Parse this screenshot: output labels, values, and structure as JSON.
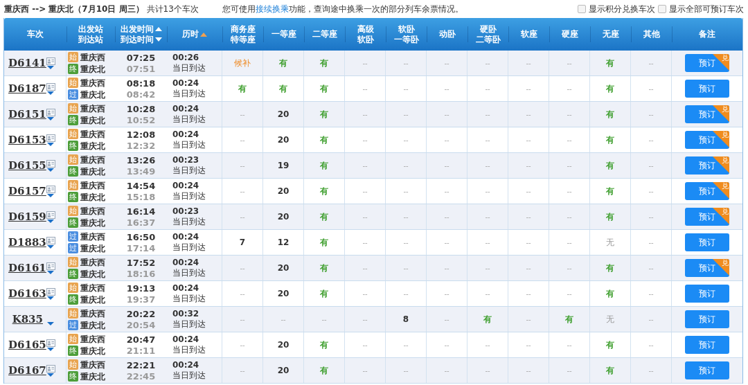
{
  "summary": {
    "route": "重庆西 --> 重庆北（7月10日  周三）",
    "count": "共计13个车次"
  },
  "notice": {
    "before": "您可使用",
    "link": "接续换乘",
    "after": "功能，查询途中换乘一次的部分列车余票情况。"
  },
  "options": [
    {
      "label": "显示积分兑换车次",
      "checked": false
    },
    {
      "label": "显示全部可预订车次",
      "checked": false
    }
  ],
  "columns": [
    {
      "lines": [
        {
          "text": "车次"
        }
      ]
    },
    {
      "lines": [
        {
          "text": "出发站"
        },
        {
          "text": "到达站"
        }
      ]
    },
    {
      "lines": [
        {
          "text": "出发时间",
          "kind": "asc",
          "active": false
        },
        {
          "text": "到达时间",
          "kind": "desc",
          "active": false
        }
      ]
    },
    {
      "lines": [
        {
          "text": "历时",
          "kind": "asc",
          "active": true
        }
      ]
    },
    {
      "lines": [
        {
          "text": "商务座"
        },
        {
          "text": "特等座"
        }
      ]
    },
    {
      "lines": [
        {
          "text": "一等座"
        }
      ]
    },
    {
      "lines": [
        {
          "text": "二等座"
        }
      ]
    },
    {
      "lines": [
        {
          "text": "高级"
        },
        {
          "text": "软卧"
        }
      ]
    },
    {
      "lines": [
        {
          "text": "软卧"
        },
        {
          "text": "一等卧"
        }
      ]
    },
    {
      "lines": [
        {
          "text": "动卧"
        }
      ]
    },
    {
      "lines": [
        {
          "text": "硬卧"
        },
        {
          "text": "二等卧"
        }
      ]
    },
    {
      "lines": [
        {
          "text": "软座"
        }
      ]
    },
    {
      "lines": [
        {
          "text": "硬座"
        }
      ]
    },
    {
      "lines": [
        {
          "text": "无座"
        }
      ]
    },
    {
      "lines": [
        {
          "text": "其他"
        }
      ]
    },
    {
      "lines": [
        {
          "text": "备注"
        }
      ]
    }
  ],
  "trains": [
    {
      "number": "D6141",
      "info_icon": true,
      "from": {
        "badge": "始",
        "kind": "start",
        "name": "重庆西"
      },
      "to": {
        "badge": "终",
        "kind": "end",
        "name": "重庆北"
      },
      "depart": "07:25",
      "arrive": "07:51",
      "duration": "00:26",
      "arrival_day": "当日到达",
      "seats": [
        {
          "text": "候补",
          "kind": "waitlist"
        },
        {
          "text": "有",
          "kind": "avail"
        },
        {
          "text": "有",
          "kind": "avail"
        },
        {
          "text": "--",
          "kind": "na"
        },
        {
          "text": "--",
          "kind": "na"
        },
        {
          "text": "--",
          "kind": "na"
        },
        {
          "text": "--",
          "kind": "na"
        },
        {
          "text": "--",
          "kind": "na"
        },
        {
          "text": "--",
          "kind": "na"
        },
        {
          "text": "有",
          "kind": "avail"
        },
        {
          "text": "--",
          "kind": "na"
        }
      ],
      "button": "预订",
      "badge": "兑"
    },
    {
      "number": "D6187",
      "info_icon": true,
      "from": {
        "badge": "始",
        "kind": "start",
        "name": "重庆西"
      },
      "to": {
        "badge": "过",
        "kind": "pass",
        "name": "重庆北"
      },
      "depart": "08:18",
      "arrive": "08:42",
      "duration": "00:24",
      "arrival_day": "当日到达",
      "seats": [
        {
          "text": "有",
          "kind": "avail"
        },
        {
          "text": "有",
          "kind": "avail"
        },
        {
          "text": "有",
          "kind": "avail"
        },
        {
          "text": "--",
          "kind": "na"
        },
        {
          "text": "--",
          "kind": "na"
        },
        {
          "text": "--",
          "kind": "na"
        },
        {
          "text": "--",
          "kind": "na"
        },
        {
          "text": "--",
          "kind": "na"
        },
        {
          "text": "--",
          "kind": "na"
        },
        {
          "text": "有",
          "kind": "avail"
        },
        {
          "text": "--",
          "kind": "na"
        }
      ],
      "button": "预订"
    },
    {
      "number": "D6151",
      "info_icon": true,
      "from": {
        "badge": "始",
        "kind": "start",
        "name": "重庆西"
      },
      "to": {
        "badge": "终",
        "kind": "end",
        "name": "重庆北"
      },
      "depart": "10:28",
      "arrive": "10:52",
      "duration": "00:24",
      "arrival_day": "当日到达",
      "seats": [
        {
          "text": "--",
          "kind": "na"
        },
        {
          "text": "20",
          "kind": "count"
        },
        {
          "text": "有",
          "kind": "avail"
        },
        {
          "text": "--",
          "kind": "na"
        },
        {
          "text": "--",
          "kind": "na"
        },
        {
          "text": "--",
          "kind": "na"
        },
        {
          "text": "--",
          "kind": "na"
        },
        {
          "text": "--",
          "kind": "na"
        },
        {
          "text": "--",
          "kind": "na"
        },
        {
          "text": "有",
          "kind": "avail"
        },
        {
          "text": "--",
          "kind": "na"
        }
      ],
      "button": "预订",
      "badge": "兑"
    },
    {
      "number": "D6153",
      "info_icon": true,
      "from": {
        "badge": "始",
        "kind": "start",
        "name": "重庆西"
      },
      "to": {
        "badge": "终",
        "kind": "end",
        "name": "重庆北"
      },
      "depart": "12:08",
      "arrive": "12:32",
      "duration": "00:24",
      "arrival_day": "当日到达",
      "seats": [
        {
          "text": "--",
          "kind": "na"
        },
        {
          "text": "20",
          "kind": "count"
        },
        {
          "text": "有",
          "kind": "avail"
        },
        {
          "text": "--",
          "kind": "na"
        },
        {
          "text": "--",
          "kind": "na"
        },
        {
          "text": "--",
          "kind": "na"
        },
        {
          "text": "--",
          "kind": "na"
        },
        {
          "text": "--",
          "kind": "na"
        },
        {
          "text": "--",
          "kind": "na"
        },
        {
          "text": "有",
          "kind": "avail"
        },
        {
          "text": "--",
          "kind": "na"
        }
      ],
      "button": "预订",
      "badge": "兑"
    },
    {
      "number": "D6155",
      "info_icon": true,
      "from": {
        "badge": "始",
        "kind": "start",
        "name": "重庆西"
      },
      "to": {
        "badge": "终",
        "kind": "end",
        "name": "重庆北"
      },
      "depart": "13:26",
      "arrive": "13:49",
      "duration": "00:23",
      "arrival_day": "当日到达",
      "seats": [
        {
          "text": "--",
          "kind": "na"
        },
        {
          "text": "19",
          "kind": "count"
        },
        {
          "text": "有",
          "kind": "avail"
        },
        {
          "text": "--",
          "kind": "na"
        },
        {
          "text": "--",
          "kind": "na"
        },
        {
          "text": "--",
          "kind": "na"
        },
        {
          "text": "--",
          "kind": "na"
        },
        {
          "text": "--",
          "kind": "na"
        },
        {
          "text": "--",
          "kind": "na"
        },
        {
          "text": "有",
          "kind": "avail"
        },
        {
          "text": "--",
          "kind": "na"
        }
      ],
      "button": "预订",
      "badge": "兑"
    },
    {
      "number": "D6157",
      "info_icon": true,
      "from": {
        "badge": "始",
        "kind": "start",
        "name": "重庆西"
      },
      "to": {
        "badge": "终",
        "kind": "end",
        "name": "重庆北"
      },
      "depart": "14:54",
      "arrive": "15:18",
      "duration": "00:24",
      "arrival_day": "当日到达",
      "seats": [
        {
          "text": "--",
          "kind": "na"
        },
        {
          "text": "20",
          "kind": "count"
        },
        {
          "text": "有",
          "kind": "avail"
        },
        {
          "text": "--",
          "kind": "na"
        },
        {
          "text": "--",
          "kind": "na"
        },
        {
          "text": "--",
          "kind": "na"
        },
        {
          "text": "--",
          "kind": "na"
        },
        {
          "text": "--",
          "kind": "na"
        },
        {
          "text": "--",
          "kind": "na"
        },
        {
          "text": "有",
          "kind": "avail"
        },
        {
          "text": "--",
          "kind": "na"
        }
      ],
      "button": "预订",
      "badge": "兑"
    },
    {
      "number": "D6159",
      "info_icon": true,
      "from": {
        "badge": "始",
        "kind": "start",
        "name": "重庆西"
      },
      "to": {
        "badge": "终",
        "kind": "end",
        "name": "重庆北"
      },
      "depart": "16:14",
      "arrive": "16:37",
      "duration": "00:23",
      "arrival_day": "当日到达",
      "seats": [
        {
          "text": "--",
          "kind": "na"
        },
        {
          "text": "20",
          "kind": "count"
        },
        {
          "text": "有",
          "kind": "avail"
        },
        {
          "text": "--",
          "kind": "na"
        },
        {
          "text": "--",
          "kind": "na"
        },
        {
          "text": "--",
          "kind": "na"
        },
        {
          "text": "--",
          "kind": "na"
        },
        {
          "text": "--",
          "kind": "na"
        },
        {
          "text": "--",
          "kind": "na"
        },
        {
          "text": "有",
          "kind": "avail"
        },
        {
          "text": "--",
          "kind": "na"
        }
      ],
      "button": "预订",
      "badge": "兑"
    },
    {
      "number": "D1883",
      "info_icon": true,
      "from": {
        "badge": "过",
        "kind": "pass",
        "name": "重庆西"
      },
      "to": {
        "badge": "过",
        "kind": "pass",
        "name": "重庆北"
      },
      "depart": "16:50",
      "arrive": "17:14",
      "duration": "00:24",
      "arrival_day": "当日到达",
      "seats": [
        {
          "text": "7",
          "kind": "count"
        },
        {
          "text": "12",
          "kind": "count"
        },
        {
          "text": "有",
          "kind": "avail"
        },
        {
          "text": "--",
          "kind": "na"
        },
        {
          "text": "--",
          "kind": "na"
        },
        {
          "text": "--",
          "kind": "na"
        },
        {
          "text": "--",
          "kind": "na"
        },
        {
          "text": "--",
          "kind": "na"
        },
        {
          "text": "--",
          "kind": "na"
        },
        {
          "text": "无",
          "kind": "none"
        },
        {
          "text": "--",
          "kind": "na"
        }
      ],
      "button": "预订"
    },
    {
      "number": "D6161",
      "info_icon": true,
      "from": {
        "badge": "始",
        "kind": "start",
        "name": "重庆西"
      },
      "to": {
        "badge": "终",
        "kind": "end",
        "name": "重庆北"
      },
      "depart": "17:52",
      "arrive": "18:16",
      "duration": "00:24",
      "arrival_day": "当日到达",
      "seats": [
        {
          "text": "--",
          "kind": "na"
        },
        {
          "text": "20",
          "kind": "count"
        },
        {
          "text": "有",
          "kind": "avail"
        },
        {
          "text": "--",
          "kind": "na"
        },
        {
          "text": "--",
          "kind": "na"
        },
        {
          "text": "--",
          "kind": "na"
        },
        {
          "text": "--",
          "kind": "na"
        },
        {
          "text": "--",
          "kind": "na"
        },
        {
          "text": "--",
          "kind": "na"
        },
        {
          "text": "有",
          "kind": "avail"
        },
        {
          "text": "--",
          "kind": "na"
        }
      ],
      "button": "预订",
      "badge": "兑"
    },
    {
      "number": "D6163",
      "info_icon": true,
      "from": {
        "badge": "始",
        "kind": "start",
        "name": "重庆西"
      },
      "to": {
        "badge": "终",
        "kind": "end",
        "name": "重庆北"
      },
      "depart": "19:13",
      "arrive": "19:37",
      "duration": "00:24",
      "arrival_day": "当日到达",
      "seats": [
        {
          "text": "--",
          "kind": "na"
        },
        {
          "text": "20",
          "kind": "count"
        },
        {
          "text": "有",
          "kind": "avail"
        },
        {
          "text": "--",
          "kind": "na"
        },
        {
          "text": "--",
          "kind": "na"
        },
        {
          "text": "--",
          "kind": "na"
        },
        {
          "text": "--",
          "kind": "na"
        },
        {
          "text": "--",
          "kind": "na"
        },
        {
          "text": "--",
          "kind": "na"
        },
        {
          "text": "有",
          "kind": "avail"
        },
        {
          "text": "--",
          "kind": "na"
        }
      ],
      "button": "预订"
    },
    {
      "number": "K835",
      "info_icon": false,
      "from": {
        "badge": "始",
        "kind": "start",
        "name": "重庆西"
      },
      "to": {
        "badge": "过",
        "kind": "pass",
        "name": "重庆北"
      },
      "depart": "20:22",
      "arrive": "20:54",
      "duration": "00:32",
      "arrival_day": "当日到达",
      "seats": [
        {
          "text": "--",
          "kind": "na"
        },
        {
          "text": "--",
          "kind": "na"
        },
        {
          "text": "--",
          "kind": "na"
        },
        {
          "text": "--",
          "kind": "na"
        },
        {
          "text": "8",
          "kind": "count"
        },
        {
          "text": "--",
          "kind": "na"
        },
        {
          "text": "有",
          "kind": "avail"
        },
        {
          "text": "--",
          "kind": "na"
        },
        {
          "text": "有",
          "kind": "avail"
        },
        {
          "text": "无",
          "kind": "none"
        },
        {
          "text": "--",
          "kind": "na"
        }
      ],
      "button": "预订"
    },
    {
      "number": "D6165",
      "info_icon": true,
      "from": {
        "badge": "始",
        "kind": "start",
        "name": "重庆西"
      },
      "to": {
        "badge": "终",
        "kind": "end",
        "name": "重庆北"
      },
      "depart": "20:47",
      "arrive": "21:11",
      "duration": "00:24",
      "arrival_day": "当日到达",
      "seats": [
        {
          "text": "--",
          "kind": "na"
        },
        {
          "text": "20",
          "kind": "count"
        },
        {
          "text": "有",
          "kind": "avail"
        },
        {
          "text": "--",
          "kind": "na"
        },
        {
          "text": "--",
          "kind": "na"
        },
        {
          "text": "--",
          "kind": "na"
        },
        {
          "text": "--",
          "kind": "na"
        },
        {
          "text": "--",
          "kind": "na"
        },
        {
          "text": "--",
          "kind": "na"
        },
        {
          "text": "有",
          "kind": "avail"
        },
        {
          "text": "--",
          "kind": "na"
        }
      ],
      "button": "预订"
    },
    {
      "number": "D6167",
      "info_icon": true,
      "from": {
        "badge": "始",
        "kind": "start",
        "name": "重庆西"
      },
      "to": {
        "badge": "终",
        "kind": "end",
        "name": "重庆北"
      },
      "depart": "22:21",
      "arrive": "22:45",
      "duration": "00:24",
      "arrival_day": "当日到达",
      "seats": [
        {
          "text": "--",
          "kind": "na"
        },
        {
          "text": "20",
          "kind": "count"
        },
        {
          "text": "有",
          "kind": "avail"
        },
        {
          "text": "--",
          "kind": "na"
        },
        {
          "text": "--",
          "kind": "na"
        },
        {
          "text": "--",
          "kind": "na"
        },
        {
          "text": "--",
          "kind": "na"
        },
        {
          "text": "--",
          "kind": "na"
        },
        {
          "text": "--",
          "kind": "na"
        },
        {
          "text": "有",
          "kind": "avail"
        },
        {
          "text": "--",
          "kind": "na"
        }
      ],
      "button": "预订"
    }
  ]
}
